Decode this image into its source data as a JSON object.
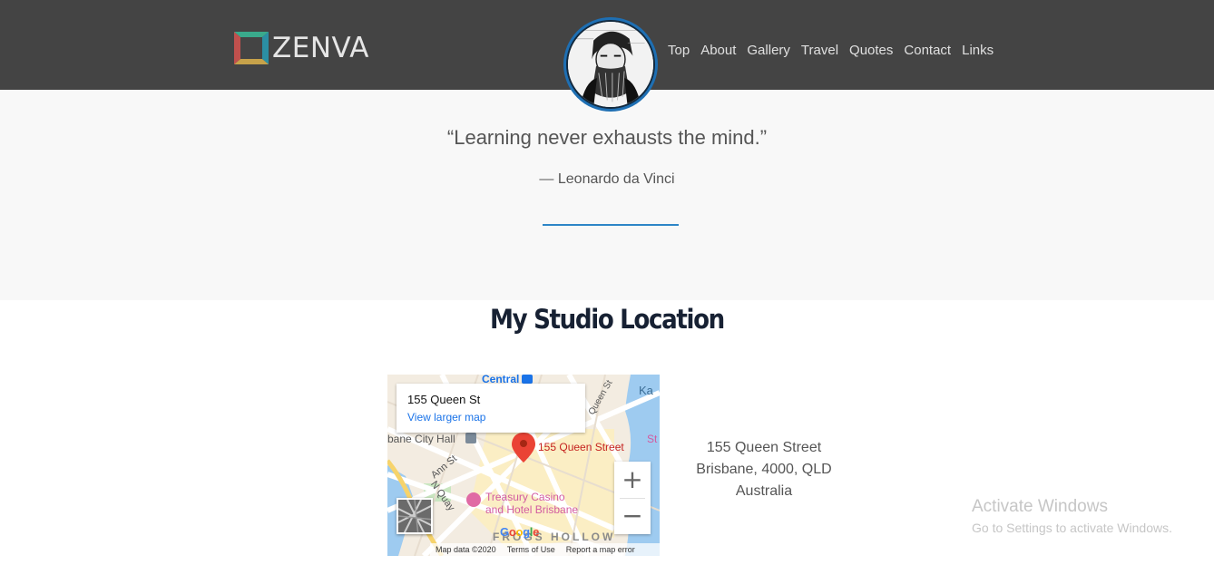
{
  "header": {
    "logo_text": "ZENVA",
    "nav": [
      "Top",
      "About",
      "Gallery",
      "Travel",
      "Quotes",
      "Contact",
      "Links"
    ]
  },
  "quote": {
    "text": "“Learning never exhausts the mind.”",
    "author": "— Leonardo da Vinci"
  },
  "location": {
    "title": "My Studio Location",
    "address": [
      "155 Queen Street",
      "Brisbane, 4000, QLD",
      "Australia"
    ]
  },
  "map": {
    "card_title": "155 Queen St",
    "card_link": "View larger map",
    "pin_label": "155 Queen Street",
    "labels": {
      "central": "Central",
      "city_hall": "bane City Hall",
      "ann_st": "Ann St",
      "n_quay": "N Quay",
      "casino_1": "Treasury Casino",
      "casino_2": "and Hotel Brisbane",
      "frogs": "FROGS HOLLOW",
      "queen_st": "Queen St",
      "ka": "Ka",
      "st": "St"
    },
    "google": "Google",
    "footer": [
      "Map data ©2020",
      "Terms of Use",
      "Report a map error"
    ],
    "zoom_in": "+",
    "zoom_out": "−"
  },
  "watermark": {
    "line1": "Activate Windows",
    "line2": "Go to Settings to activate Windows."
  },
  "colors": {
    "navbar": "#444444",
    "accent": "#2d86c7",
    "title": "#172133",
    "quote_bg": "#f8f8f8"
  }
}
